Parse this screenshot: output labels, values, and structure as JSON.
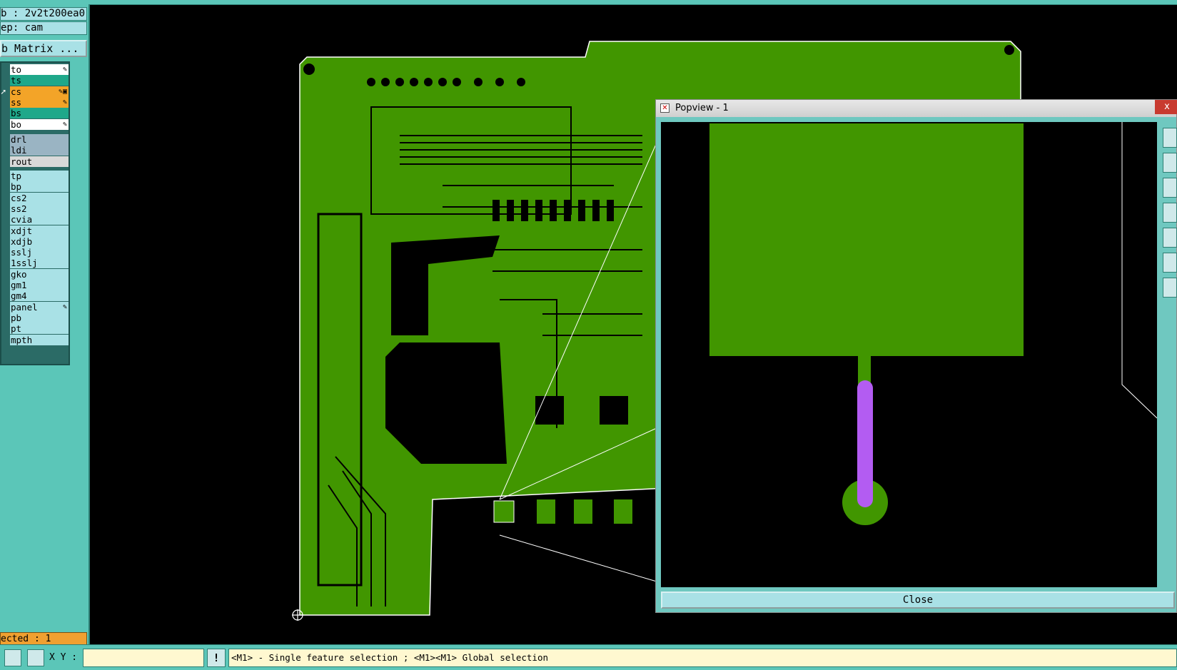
{
  "job_label": "b : 2v2t200ea0",
  "step_label": "ep: cam",
  "matrix_button": "b Matrix ...",
  "layers_board": [
    {
      "name": "to",
      "color": "white",
      "mark": "✎"
    },
    {
      "name": "ts",
      "color": "teal",
      "mark": ""
    },
    {
      "name": "cs",
      "color": "orange",
      "mark": "✎▣"
    },
    {
      "name": "ss",
      "color": "orange",
      "mark": "✎"
    },
    {
      "name": "bs",
      "color": "teal",
      "mark": ""
    },
    {
      "name": "bo",
      "color": "white",
      "mark": "✎"
    }
  ],
  "layers_drill": [
    {
      "name": "drl",
      "color": "gray"
    },
    {
      "name": "ldi",
      "color": "gray"
    },
    {
      "name": "rout",
      "color": "lgray"
    }
  ],
  "layers_misc": [
    {
      "name": "tp"
    },
    {
      "name": "bp"
    },
    {
      "name": "cs2"
    },
    {
      "name": "ss2"
    },
    {
      "name": "cvia"
    },
    {
      "name": "xdjt"
    },
    {
      "name": "xdjb"
    },
    {
      "name": "sslj"
    },
    {
      "name": "1sslj"
    },
    {
      "name": "gko"
    },
    {
      "name": "gm1"
    },
    {
      "name": "gm4"
    },
    {
      "name": "panel",
      "mark": "✎"
    },
    {
      "name": "pb"
    },
    {
      "name": "pt"
    },
    {
      "name": "mpth"
    }
  ],
  "selected_label": "ected : 1",
  "status": {
    "xy_label": "X Y :",
    "xy_value": "",
    "message": "<M1> - Single feature selection ; <M1><M1> Global selection",
    "warn_icon": "!"
  },
  "popview": {
    "title": "Popview - 1",
    "close_button": "Close",
    "close_x": "x"
  },
  "colors": {
    "copper": "#419600",
    "highlight": "#b35cf2",
    "panel_bg": "#5bc6b8"
  }
}
